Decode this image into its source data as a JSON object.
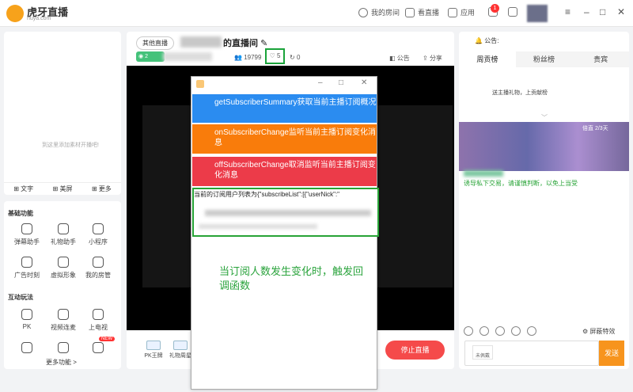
{
  "app": {
    "logo_text": "虎牙直播",
    "logo_sub": "huya.com"
  },
  "topbar": {
    "my_room": "我的房间",
    "watch_live": "看直播",
    "apps": "应用",
    "notification_count": "1"
  },
  "left": {
    "empty_hint": "到这里添加素材开播吧!",
    "tools": [
      "文字",
      "美屏",
      "更多"
    ],
    "basic_title": "基础功能",
    "basic_items": [
      "弹幕助手",
      "礼物助手",
      "小程序",
      "广告时刻",
      "虚拟形象",
      "我的房管"
    ],
    "interact_title": "互动玩法",
    "interact_items": [
      "PK",
      "视频连麦",
      "上电视"
    ],
    "new_tag": "NEW",
    "more_label": "更多功能 >"
  },
  "center": {
    "category": "其他直播",
    "room_title_suffix": "的直播间",
    "viewers": "19799",
    "likes": "5",
    "shares": "0",
    "notice_btn": "公告",
    "share_btn": "分享",
    "badge_prefix": "2",
    "bottom_tools": [
      "PK王牌",
      "礼物周星"
    ],
    "stop_btn": "停止直播"
  },
  "popup": {
    "btn1": "getSubscriberSummary获取当前主播订阅概况",
    "btn2": "onSubscriberChange监听当前主播订阅变化消息",
    "btn3": "offSubscriberChange取消监听当前主播订阅变化消息",
    "result": "当前的订阅用户列表为{\"subscribeList\":[{\"userNick\":\"",
    "annotation": "当订阅人数发生变化时，触发回调函数"
  },
  "right": {
    "notice_label": "公告:",
    "tabs": [
      "周贡榜",
      "粉丝榜",
      "贵宾"
    ],
    "rank_empty": "送主播礼物，上贡献榜",
    "mosaic_tag": "倍直 2/3天",
    "sys_message": "诱导私下交易，请谨慎判断，以免上当受",
    "block_effects": "屏蔽特效",
    "fan_badge": "未佩戴",
    "send_btn": "发送"
  }
}
